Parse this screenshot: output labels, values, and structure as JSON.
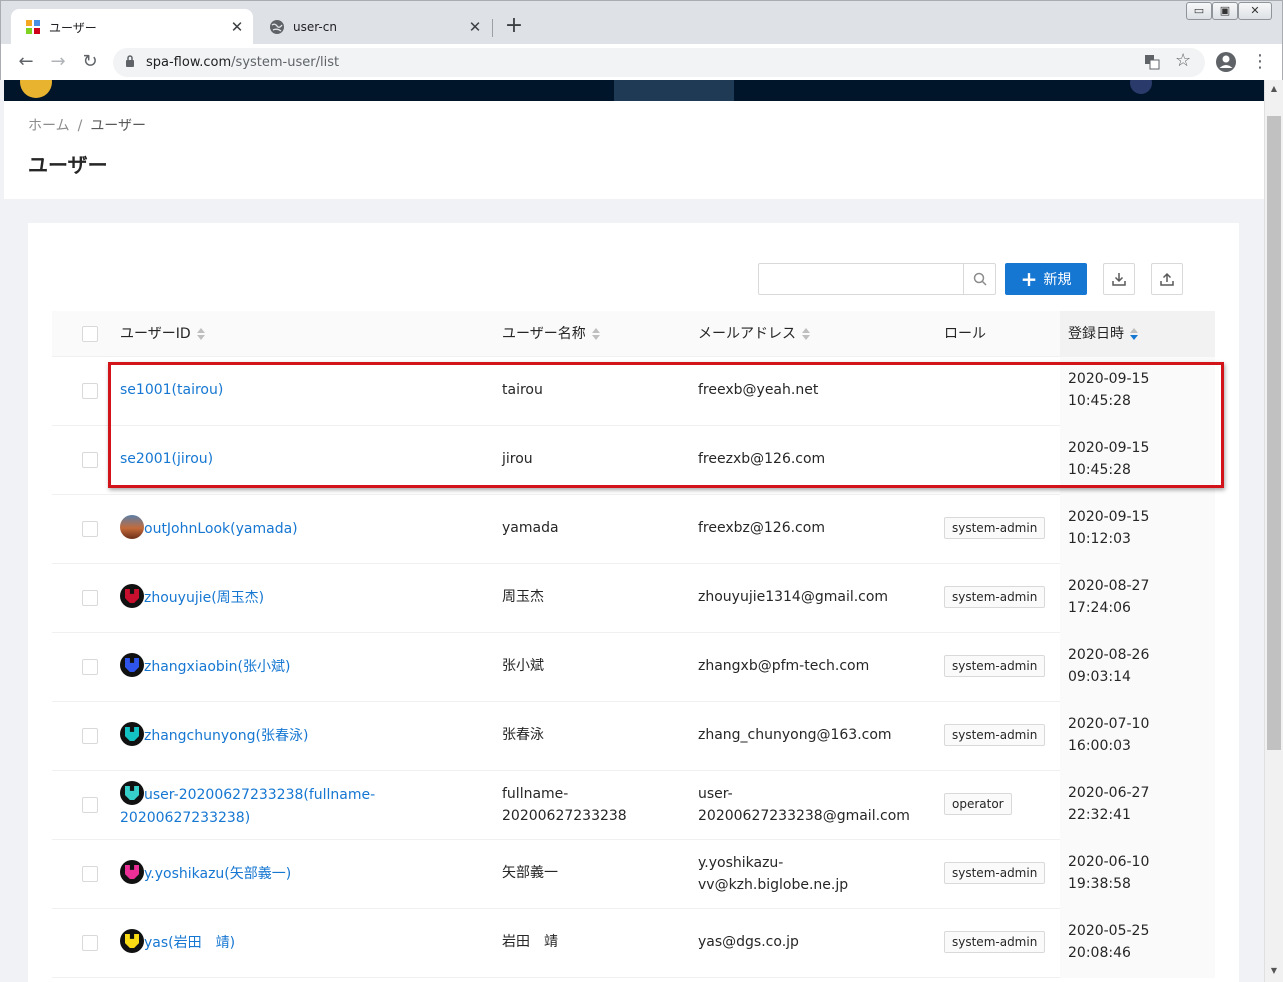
{
  "browser": {
    "tabs": [
      {
        "title": "ユーザー",
        "active": true
      },
      {
        "title": "user-cn",
        "active": false
      }
    ],
    "url_host": "spa-flow.com",
    "url_path": "/system-user/list"
  },
  "breadcrumb": {
    "home": "ホーム",
    "separator": "/",
    "current": "ユーザー"
  },
  "page_title": "ユーザー",
  "toolbar": {
    "new_label": "新規",
    "search_placeholder": ""
  },
  "columns": {
    "user_id": "ユーザーID",
    "user_name": "ユーザー名称",
    "email": "メールアドレス",
    "role": "ロール",
    "registered": "登録日時"
  },
  "rows": [
    {
      "id": "se1001(tairou)",
      "id2": "",
      "name": "tairou",
      "name2": "",
      "email": "freexb@yeah.net",
      "email2": "",
      "role": "",
      "date": "2020-09-15",
      "time": "10:45:28",
      "avatar": ""
    },
    {
      "id": "se2001(jirou)",
      "id2": "",
      "name": "jirou",
      "name2": "",
      "email": "freezxb@126.com",
      "email2": "",
      "role": "",
      "date": "2020-09-15",
      "time": "10:45:28",
      "avatar": ""
    },
    {
      "id": "outJohnLook(yamada)",
      "id2": "",
      "name": "yamada",
      "name2": "",
      "email": "freexbz@126.com",
      "email2": "",
      "role": "system-admin",
      "date": "2020-09-15",
      "time": "10:12:03",
      "avatar": "photo"
    },
    {
      "id": "zhouyujie(周玉杰)",
      "id2": "",
      "name": "周玉杰",
      "name2": "",
      "email": "zhouyujie1314@gmail.com",
      "email2": "",
      "role": "system-admin",
      "date": "2020-08-27",
      "time": "17:24:06",
      "avatar": "#c8102e"
    },
    {
      "id": "zhangxiaobin(张小斌)",
      "id2": "",
      "name": "张小斌",
      "name2": "",
      "email": "zhangxb@pfm-tech.com",
      "email2": "",
      "role": "system-admin",
      "date": "2020-08-26",
      "time": "09:03:14",
      "avatar": "#2f54eb"
    },
    {
      "id": "zhangchunyong(张春泳)",
      "id2": "",
      "name": "张春泳",
      "name2": "",
      "email": "zhang_chunyong@163.com",
      "email2": "",
      "role": "system-admin",
      "date": "2020-07-10",
      "time": "16:00:03",
      "avatar": "#13c2c2"
    },
    {
      "id": "user-20200627233238(fullname-",
      "id2": "20200627233238)",
      "name": "fullname-",
      "name2": "20200627233238",
      "email": "user-",
      "email2": "20200627233238@gmail.com",
      "role": "operator",
      "date": "2020-06-27",
      "time": "22:32:41",
      "avatar": "#36cfc9"
    },
    {
      "id": "y.yoshikazu(矢部義一)",
      "id2": "",
      "name": "矢部義一",
      "name2": "",
      "email": "y.yoshikazu-",
      "email2": "vv@kzh.biglobe.ne.jp",
      "role": "system-admin",
      "date": "2020-06-10",
      "time": "19:38:58",
      "avatar": "#eb2f96"
    },
    {
      "id": "yas(岩田　靖)",
      "id2": "",
      "name": "岩田　靖",
      "name2": "",
      "email": "yas@dgs.co.jp",
      "email2": "",
      "role": "system-admin",
      "date": "2020-05-25",
      "time": "20:08:46",
      "avatar": "#fadb14"
    }
  ],
  "colors": {
    "primary": "#1677d2",
    "header_bg": "#001529",
    "highlight": "#d3131a"
  }
}
